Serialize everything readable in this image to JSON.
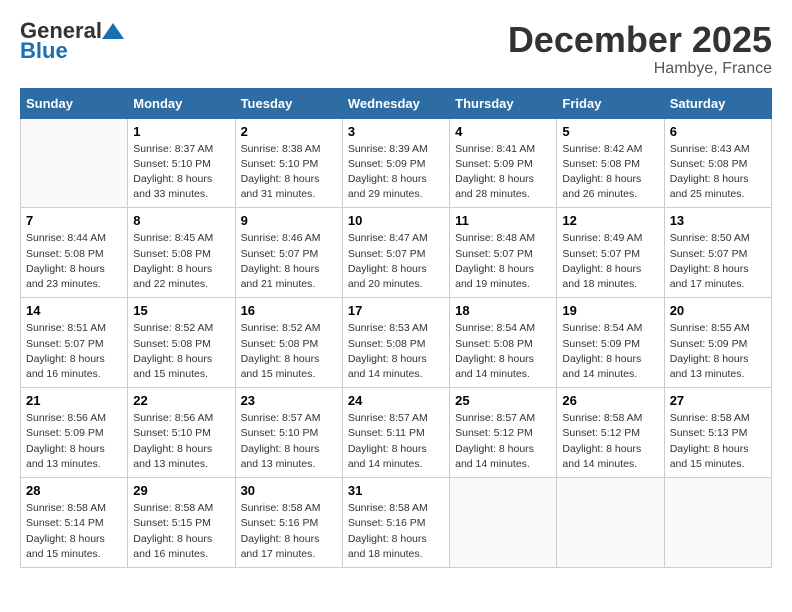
{
  "header": {
    "logo_general": "General",
    "logo_blue": "Blue",
    "month_title": "December 2025",
    "location": "Hambye, France"
  },
  "days_of_week": [
    "Sunday",
    "Monday",
    "Tuesday",
    "Wednesday",
    "Thursday",
    "Friday",
    "Saturday"
  ],
  "weeks": [
    [
      {
        "day": "",
        "info": ""
      },
      {
        "day": "1",
        "info": "Sunrise: 8:37 AM\nSunset: 5:10 PM\nDaylight: 8 hours\nand 33 minutes."
      },
      {
        "day": "2",
        "info": "Sunrise: 8:38 AM\nSunset: 5:10 PM\nDaylight: 8 hours\nand 31 minutes."
      },
      {
        "day": "3",
        "info": "Sunrise: 8:39 AM\nSunset: 5:09 PM\nDaylight: 8 hours\nand 29 minutes."
      },
      {
        "day": "4",
        "info": "Sunrise: 8:41 AM\nSunset: 5:09 PM\nDaylight: 8 hours\nand 28 minutes."
      },
      {
        "day": "5",
        "info": "Sunrise: 8:42 AM\nSunset: 5:08 PM\nDaylight: 8 hours\nand 26 minutes."
      },
      {
        "day": "6",
        "info": "Sunrise: 8:43 AM\nSunset: 5:08 PM\nDaylight: 8 hours\nand 25 minutes."
      }
    ],
    [
      {
        "day": "7",
        "info": "Sunrise: 8:44 AM\nSunset: 5:08 PM\nDaylight: 8 hours\nand 23 minutes."
      },
      {
        "day": "8",
        "info": "Sunrise: 8:45 AM\nSunset: 5:08 PM\nDaylight: 8 hours\nand 22 minutes."
      },
      {
        "day": "9",
        "info": "Sunrise: 8:46 AM\nSunset: 5:07 PM\nDaylight: 8 hours\nand 21 minutes."
      },
      {
        "day": "10",
        "info": "Sunrise: 8:47 AM\nSunset: 5:07 PM\nDaylight: 8 hours\nand 20 minutes."
      },
      {
        "day": "11",
        "info": "Sunrise: 8:48 AM\nSunset: 5:07 PM\nDaylight: 8 hours\nand 19 minutes."
      },
      {
        "day": "12",
        "info": "Sunrise: 8:49 AM\nSunset: 5:07 PM\nDaylight: 8 hours\nand 18 minutes."
      },
      {
        "day": "13",
        "info": "Sunrise: 8:50 AM\nSunset: 5:07 PM\nDaylight: 8 hours\nand 17 minutes."
      }
    ],
    [
      {
        "day": "14",
        "info": "Sunrise: 8:51 AM\nSunset: 5:07 PM\nDaylight: 8 hours\nand 16 minutes."
      },
      {
        "day": "15",
        "info": "Sunrise: 8:52 AM\nSunset: 5:08 PM\nDaylight: 8 hours\nand 15 minutes."
      },
      {
        "day": "16",
        "info": "Sunrise: 8:52 AM\nSunset: 5:08 PM\nDaylight: 8 hours\nand 15 minutes."
      },
      {
        "day": "17",
        "info": "Sunrise: 8:53 AM\nSunset: 5:08 PM\nDaylight: 8 hours\nand 14 minutes."
      },
      {
        "day": "18",
        "info": "Sunrise: 8:54 AM\nSunset: 5:08 PM\nDaylight: 8 hours\nand 14 minutes."
      },
      {
        "day": "19",
        "info": "Sunrise: 8:54 AM\nSunset: 5:09 PM\nDaylight: 8 hours\nand 14 minutes."
      },
      {
        "day": "20",
        "info": "Sunrise: 8:55 AM\nSunset: 5:09 PM\nDaylight: 8 hours\nand 13 minutes."
      }
    ],
    [
      {
        "day": "21",
        "info": "Sunrise: 8:56 AM\nSunset: 5:09 PM\nDaylight: 8 hours\nand 13 minutes."
      },
      {
        "day": "22",
        "info": "Sunrise: 8:56 AM\nSunset: 5:10 PM\nDaylight: 8 hours\nand 13 minutes."
      },
      {
        "day": "23",
        "info": "Sunrise: 8:57 AM\nSunset: 5:10 PM\nDaylight: 8 hours\nand 13 minutes."
      },
      {
        "day": "24",
        "info": "Sunrise: 8:57 AM\nSunset: 5:11 PM\nDaylight: 8 hours\nand 14 minutes."
      },
      {
        "day": "25",
        "info": "Sunrise: 8:57 AM\nSunset: 5:12 PM\nDaylight: 8 hours\nand 14 minutes."
      },
      {
        "day": "26",
        "info": "Sunrise: 8:58 AM\nSunset: 5:12 PM\nDaylight: 8 hours\nand 14 minutes."
      },
      {
        "day": "27",
        "info": "Sunrise: 8:58 AM\nSunset: 5:13 PM\nDaylight: 8 hours\nand 15 minutes."
      }
    ],
    [
      {
        "day": "28",
        "info": "Sunrise: 8:58 AM\nSunset: 5:14 PM\nDaylight: 8 hours\nand 15 minutes."
      },
      {
        "day": "29",
        "info": "Sunrise: 8:58 AM\nSunset: 5:15 PM\nDaylight: 8 hours\nand 16 minutes."
      },
      {
        "day": "30",
        "info": "Sunrise: 8:58 AM\nSunset: 5:16 PM\nDaylight: 8 hours\nand 17 minutes."
      },
      {
        "day": "31",
        "info": "Sunrise: 8:58 AM\nSunset: 5:16 PM\nDaylight: 8 hours\nand 18 minutes."
      },
      {
        "day": "",
        "info": ""
      },
      {
        "day": "",
        "info": ""
      },
      {
        "day": "",
        "info": ""
      }
    ]
  ]
}
